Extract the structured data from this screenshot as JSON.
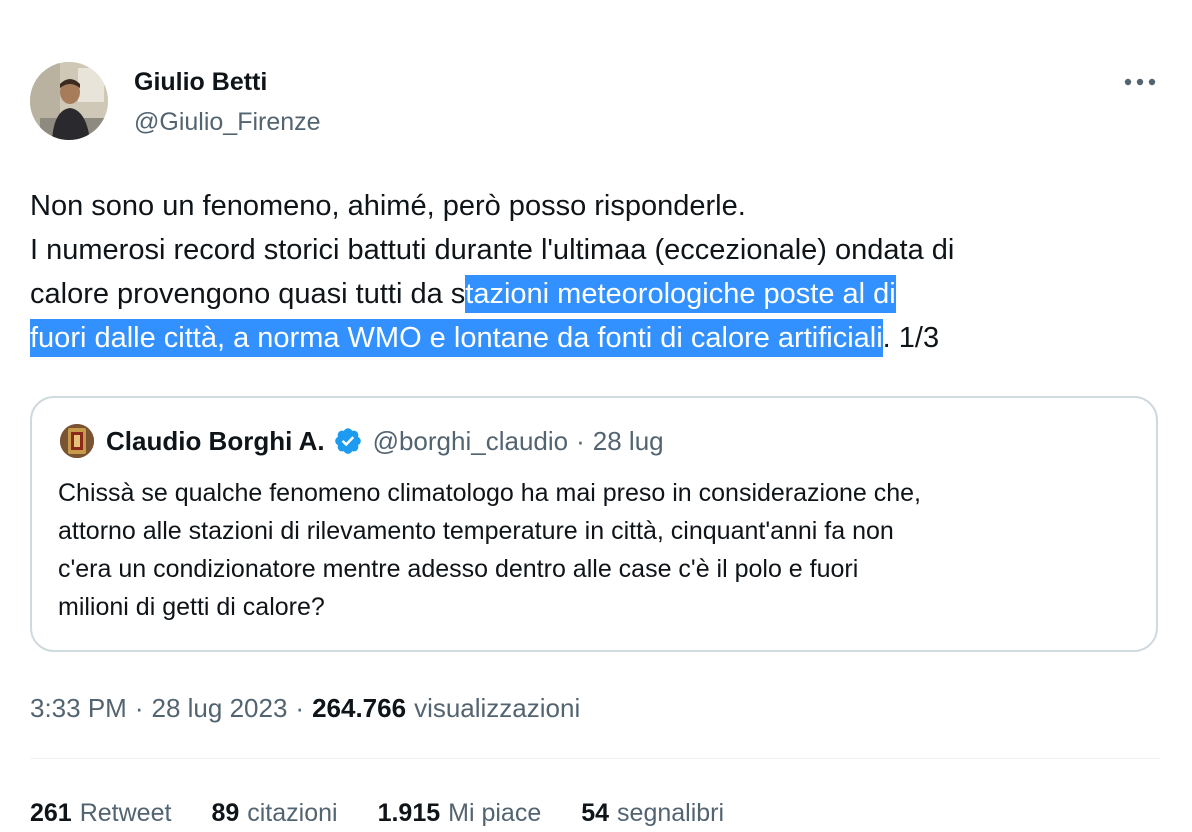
{
  "author": {
    "display_name": "Giulio Betti",
    "handle": "@Giulio_Firenze"
  },
  "tweet": {
    "lines": [
      [
        {
          "text": "Non sono un fenomeno, ahimé, però posso risponderle.",
          "highlight": false
        }
      ],
      [
        {
          "text": "I numerosi record storici battuti durante l'ultimaa (eccezionale) ondata di",
          "highlight": false
        }
      ],
      [
        {
          "text": "calore provengono quasi tutti da s",
          "highlight": false
        },
        {
          "text": "tazioni meteorologiche poste al di ",
          "highlight": true
        }
      ],
      [
        {
          "text": "fuori dalle città, a norma WMO e lontane da fonti di calore artificiali",
          "highlight": true
        },
        {
          "text": ". 1/3",
          "highlight": false
        }
      ]
    ]
  },
  "quote": {
    "name": "Claudio Borghi A.",
    "handle": "@borghi_claudio",
    "separator": "·",
    "date": "28 lug",
    "lines": [
      "Chissà se qualche fenomeno climatologo ha mai preso in considerazione che,",
      "attorno alle stazioni di rilevamento temperature in città, cinquant'anni fa non",
      "c'era un condizionatore mentre adesso dentro alle case c'è il polo e fuori",
      "milioni di getti di calore?"
    ]
  },
  "meta": {
    "time": "3:33 PM",
    "separator": "·",
    "date": "28 lug 2023",
    "views_count": "264.766",
    "views_label": "visualizzazioni"
  },
  "stats": [
    {
      "count": "261",
      "label": "Retweet"
    },
    {
      "count": "89",
      "label": "citazioni"
    },
    {
      "count": "1.915",
      "label": "Mi piace"
    },
    {
      "count": "54",
      "label": "segnalibri"
    }
  ],
  "icons": {
    "more": "more-horizontal-icon",
    "verified": "verified-badge-icon"
  },
  "colors": {
    "text": "#0f1419",
    "secondary": "#536471",
    "verified": "#1d9bf0",
    "selection": "#3390ff",
    "border": "#cfd9de"
  }
}
